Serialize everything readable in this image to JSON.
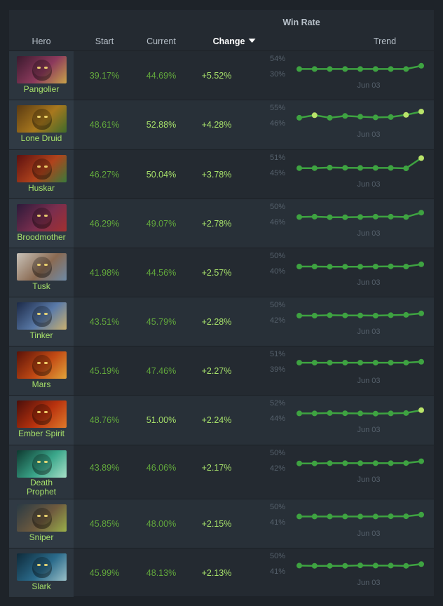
{
  "header": {
    "group_label": "Win Rate",
    "col_hero": "Hero",
    "col_start": "Start",
    "col_current": "Current",
    "col_change": "Change",
    "col_trend": "Trend"
  },
  "colors": {
    "accent_green": "#a6e06a",
    "positive_green": "#62a83c",
    "line_green": "#3ea341",
    "highlight_dot": "#b9e36a"
  },
  "rows": [
    {
      "hero": "Pangolier",
      "start": "39.17%",
      "current": "44.69%",
      "change": "+5.52%",
      "current_highlight": false,
      "trend_max": "54%",
      "trend_min": "30%",
      "trend_date": "Jun 03",
      "trend_values": [
        0.06,
        0.06,
        0.06,
        0.06,
        0.06,
        0.06,
        0.06,
        0.06,
        0.24
      ],
      "highlight_last": false,
      "highlight_points": [],
      "portrait_colors": [
        "#3b1a2e",
        "#8c3a5c",
        "#c9a34a"
      ]
    },
    {
      "hero": "Lone Druid",
      "start": "48.61%",
      "current": "52.88%",
      "change": "+4.28%",
      "current_highlight": true,
      "trend_max": "55%",
      "trend_min": "46%",
      "trend_date": "Jun 03",
      "trend_values": [
        0.08,
        0.22,
        0.08,
        0.18,
        0.14,
        0.1,
        0.12,
        0.24,
        0.42
      ],
      "highlight_last": true,
      "highlight_points": [
        1,
        7
      ],
      "portrait_colors": [
        "#5a3a12",
        "#a8781e",
        "#3f6b2a"
      ]
    },
    {
      "hero": "Huskar",
      "start": "46.27%",
      "current": "50.04%",
      "change": "+3.78%",
      "current_highlight": true,
      "trend_max": "51%",
      "trend_min": "45%",
      "trend_date": "Jun 03",
      "trend_values": [
        0.05,
        0.05,
        0.08,
        0.07,
        0.06,
        0.06,
        0.06,
        0.04,
        0.6
      ],
      "highlight_last": true,
      "highlight_points": [],
      "portrait_colors": [
        "#5c1010",
        "#b0431c",
        "#3a7a3a"
      ]
    },
    {
      "hero": "Broodmother",
      "start": "46.29%",
      "current": "49.07%",
      "change": "+2.78%",
      "current_highlight": false,
      "trend_max": "50%",
      "trend_min": "46%",
      "trend_date": "Jun 03",
      "trend_values": [
        0.06,
        0.08,
        0.05,
        0.05,
        0.06,
        0.08,
        0.08,
        0.06,
        0.3
      ],
      "highlight_last": false,
      "highlight_points": [],
      "portrait_colors": [
        "#2c1a3a",
        "#7a2e4e",
        "#a33030"
      ]
    },
    {
      "hero": "Tusk",
      "start": "41.98%",
      "current": "44.56%",
      "change": "+2.57%",
      "current_highlight": false,
      "trend_max": "50%",
      "trend_min": "40%",
      "trend_date": "Jun 03",
      "trend_values": [
        0.04,
        0.04,
        0.03,
        0.03,
        0.03,
        0.04,
        0.05,
        0.04,
        0.16
      ],
      "highlight_last": false,
      "highlight_points": [],
      "portrait_colors": [
        "#c8c2b8",
        "#8a6a52",
        "#6e8aa6"
      ]
    },
    {
      "hero": "Tinker",
      "start": "43.51%",
      "current": "45.79%",
      "change": "+2.28%",
      "current_highlight": false,
      "trend_max": "50%",
      "trend_min": "42%",
      "trend_date": "Jun 03",
      "trend_values": [
        0.04,
        0.04,
        0.06,
        0.05,
        0.05,
        0.04,
        0.06,
        0.08,
        0.16
      ],
      "highlight_last": false,
      "highlight_points": [],
      "portrait_colors": [
        "#1c2a48",
        "#5a7aa8",
        "#c9b070"
      ]
    },
    {
      "hero": "Mars",
      "start": "45.19%",
      "current": "47.46%",
      "change": "+2.27%",
      "current_highlight": false,
      "trend_max": "51%",
      "trend_min": "39%",
      "trend_date": "Jun 03",
      "trend_values": [
        0.15,
        0.15,
        0.15,
        0.15,
        0.15,
        0.15,
        0.15,
        0.15,
        0.2
      ],
      "highlight_last": false,
      "highlight_points": [],
      "portrait_colors": [
        "#5a1208",
        "#c24a14",
        "#e2a43a"
      ]
    },
    {
      "hero": "Ember Spirit",
      "start": "48.76%",
      "current": "51.00%",
      "change": "+2.24%",
      "current_highlight": true,
      "trend_max": "52%",
      "trend_min": "44%",
      "trend_date": "Jun 03",
      "trend_values": [
        0.06,
        0.06,
        0.08,
        0.07,
        0.06,
        0.05,
        0.06,
        0.08,
        0.24
      ],
      "highlight_last": true,
      "highlight_points": [],
      "portrait_colors": [
        "#4a0e0a",
        "#b8320e",
        "#e07a2a"
      ]
    },
    {
      "hero": "Death Prophet",
      "start": "43.89%",
      "current": "46.06%",
      "change": "+2.17%",
      "current_highlight": false,
      "trend_max": "50%",
      "trend_min": "42%",
      "trend_date": "Jun 03",
      "trend_values": [
        0.05,
        0.05,
        0.06,
        0.06,
        0.06,
        0.06,
        0.06,
        0.07,
        0.17
      ],
      "highlight_last": false,
      "highlight_points": [],
      "portrait_colors": [
        "#0e3a30",
        "#3aa68a",
        "#a8e0c8"
      ]
    },
    {
      "hero": "Sniper",
      "start": "45.85%",
      "current": "48.00%",
      "change": "+2.15%",
      "current_highlight": false,
      "trend_max": "50%",
      "trend_min": "41%",
      "trend_date": "Jun 03",
      "trend_values": [
        0.1,
        0.1,
        0.1,
        0.1,
        0.1,
        0.1,
        0.11,
        0.11,
        0.2
      ],
      "highlight_last": false,
      "highlight_points": [],
      "portrait_colors": [
        "#2a3a44",
        "#6e5a3e",
        "#9ab04a"
      ]
    },
    {
      "hero": "Slark",
      "start": "45.99%",
      "current": "48.13%",
      "change": "+2.13%",
      "current_highlight": false,
      "trend_max": "50%",
      "trend_min": "41%",
      "trend_date": "Jun 03",
      "trend_values": [
        0.1,
        0.09,
        0.09,
        0.09,
        0.11,
        0.1,
        0.1,
        0.09,
        0.18
      ],
      "highlight_last": false,
      "highlight_points": [],
      "portrait_colors": [
        "#0e2a3a",
        "#2a6a8a",
        "#9ac0c8"
      ]
    }
  ]
}
